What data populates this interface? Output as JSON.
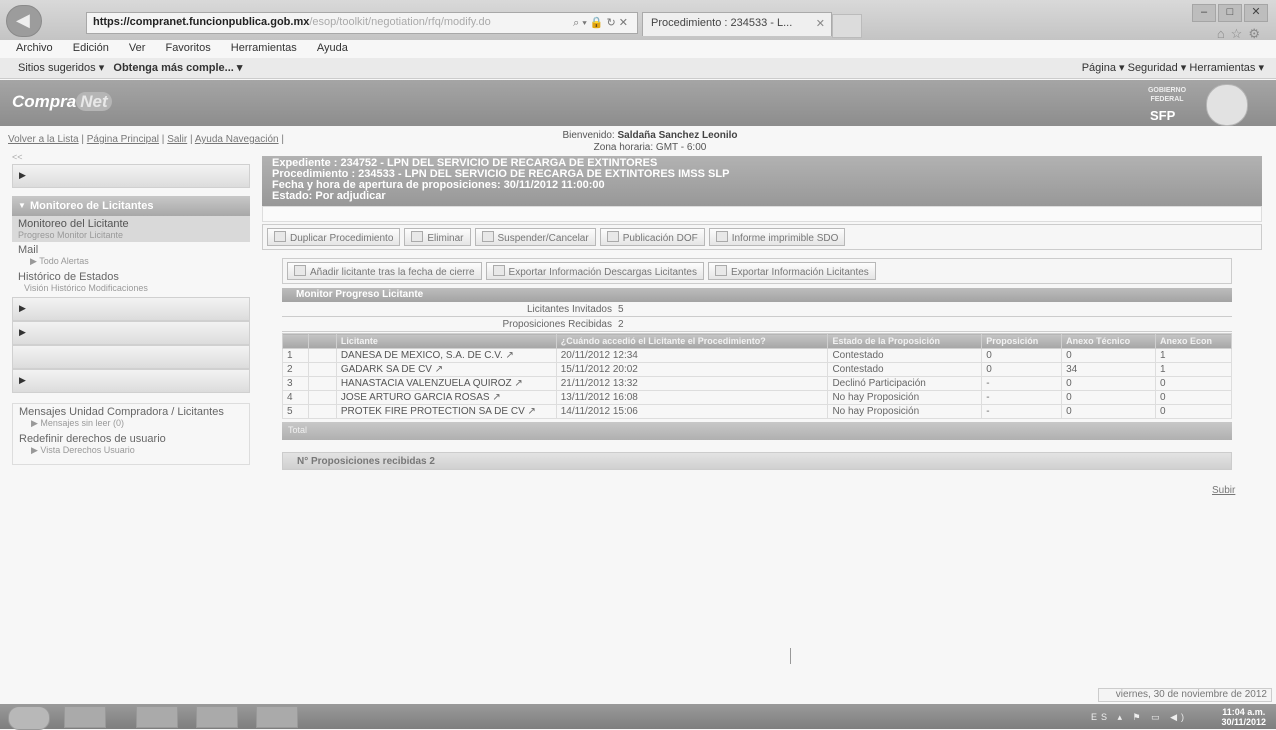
{
  "browser": {
    "url_domain": "https://compranet.funcionpublica.gob.mx",
    "url_rest": "/esop/toolkit/negotiation/rfq/modify.do",
    "tab_title": "Procedimiento : 234533 - L...",
    "menu": [
      "Archivo",
      "Edición",
      "Ver",
      "Favoritos",
      "Herramientas",
      "Ayuda"
    ],
    "fav_sugeridos": "Sitios sugeridos ▾",
    "fav_obtenga": "Obtenga más comple... ▾",
    "right_tools": "Página ▾   Seguridad ▾   Herramientas ▾"
  },
  "banner": {
    "logo_compra": "Compra",
    "logo_net": "Net",
    "gov_text": "GOBIERNO FEDERAL",
    "sfp": "SFP"
  },
  "toplinks": {
    "volver": "Volver a la Lista",
    "pagina": "Página Principal",
    "salir": "Salir",
    "ayuda": "Ayuda Navegación"
  },
  "welcome": {
    "line1_prefix": "Bienvenido:",
    "user": "Saldaña Sanchez Leonilo",
    "line2": "Zona horaria: GMT - 6:00"
  },
  "sidebar": {
    "header": "Monitoreo de Licitantes",
    "active_item": "Monitoreo del Licitante",
    "active_sub": "Progreso Monitor Licitante",
    "mail": "Mail",
    "mail_sub": "Todo Alertas",
    "historico": "Histórico de Estados",
    "historico_sub": "Visión Histórico Modificaciones",
    "mensajes": "Mensajes Unidad Compradora / Licitantes",
    "mensajes_sub": "Mensajes sin leer (0)",
    "redefinir": "Redefinir derechos de usuario",
    "redefinir_sub": "Vista Derechos Usuario"
  },
  "expediente": {
    "line1": "Expediente : 234752 - LPN DEL SERVICIO DE RECARGA DE EXTINTORES",
    "line2": "Procedimiento : 234533 - LPN DEL SERVICIO DE RECARGA DE EXTINTORES IMSS SLP",
    "line3": "Fecha y hora de apertura de proposiciones: 30/11/2012 11:00:00",
    "line4": "Estado: Por adjudicar"
  },
  "actions": {
    "duplicar": "Duplicar Procedimiento",
    "eliminar": "Eliminar",
    "suspender": "Suspender/Cancelar",
    "publicacion": "Publicación DOF",
    "informe": "Informe imprimible SDO"
  },
  "actions2": {
    "anadir": "Añadir licitante tras la fecha de cierre",
    "exp_descargas": "Exportar Información Descargas Licitantes",
    "exp_licitantes": "Exportar Información Licitantes"
  },
  "monitor": {
    "title": "Monitor Progreso Licitante",
    "invitados_label": "Licitantes Invitados",
    "invitados_value": "5",
    "recibidas_label": "Proposiciones Recibidas",
    "recibidas_value": "2"
  },
  "table": {
    "headers": [
      "",
      "",
      "Licitante",
      "¿Cuándo accedió el Licitante el Procedimiento?",
      "Estado de la Proposición",
      "Proposición",
      "Anexo Técnico",
      "Anexo Econ"
    ],
    "rows": [
      {
        "n": "1",
        "name": "DANESA DE MEXICO, S.A. DE C.V.",
        "date": "20/11/2012 12:34",
        "estado": "Contestado",
        "prop": "0",
        "tec": "0",
        "econ": "1"
      },
      {
        "n": "2",
        "name": "GADARK SA DE CV",
        "date": "15/11/2012 20:02",
        "estado": "Contestado",
        "prop": "0",
        "tec": "34",
        "econ": "1"
      },
      {
        "n": "3",
        "name": "HANASTACIA VALENZUELA QUIROZ",
        "date": "21/11/2012 13:32",
        "estado": "Declinó Participación",
        "prop": "-",
        "tec": "0",
        "econ": "0"
      },
      {
        "n": "4",
        "name": "JOSE ARTURO GARCIA ROSAS",
        "date": "13/11/2012 16:08",
        "estado": "No hay Proposición",
        "prop": "-",
        "tec": "0",
        "econ": "0"
      },
      {
        "n": "5",
        "name": "PROTEK FIRE PROTECTION SA DE CV",
        "date": "14/11/2012 15:06",
        "estado": "No hay Proposición",
        "prop": "-",
        "tec": "0",
        "econ": "0"
      }
    ],
    "footer": "Total"
  },
  "proposiciones_bar": "N° Proposiciones recibidas 2",
  "subir": "Subir",
  "taskbar": {
    "date_tooltip": "viernes, 30 de noviembre de 2012",
    "lang": "ES",
    "time": "11:04 a.m.",
    "date": "30/11/2012"
  }
}
